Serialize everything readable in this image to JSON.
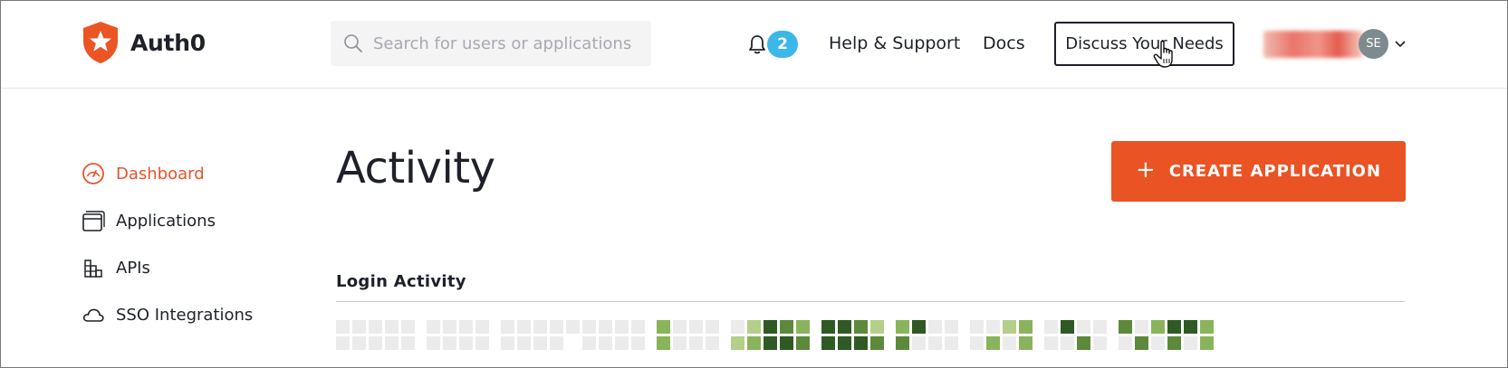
{
  "header": {
    "brand": "Auth0",
    "search_placeholder": "Search for users or applications",
    "notification_count": "2",
    "help_label": "Help & Support",
    "docs_label": "Docs",
    "discuss_label": "Discuss Your Needs",
    "avatar_initials": "SE"
  },
  "sidebar": {
    "items": [
      {
        "label": "Dashboard",
        "icon": "gauge-icon",
        "active": true
      },
      {
        "label": "Applications",
        "icon": "window-stack-icon",
        "active": false
      },
      {
        "label": "APIs",
        "icon": "building-blocks-icon",
        "active": false
      },
      {
        "label": "SSO Integrations",
        "icon": "cloud-icon",
        "active": false
      }
    ]
  },
  "main": {
    "title": "Activity",
    "create_button_label": "CREATE APPLICATION",
    "login_activity_title": "Login Activity"
  },
  "colors": {
    "accent": "#ea5323",
    "active_nav": "#e8532a",
    "badge": "#3db7ea",
    "heat_empty": "#ebebeb",
    "heat_1": "#b3cf8a",
    "heat_2": "#8ab45c",
    "heat_3": "#5d8a3a",
    "heat_4": "#2f5a23"
  },
  "heatmap": {
    "columns": [
      [
        0,
        0
      ],
      [
        0,
        0
      ],
      [
        0,
        0
      ],
      [
        0,
        0
      ],
      [
        0,
        0
      ],
      [
        -1,
        -1
      ],
      [
        0,
        0
      ],
      [
        0,
        0
      ],
      [
        0,
        0
      ],
      [
        0,
        0
      ],
      [
        -1,
        -1
      ],
      [
        0,
        0
      ],
      [
        0,
        0
      ],
      [
        0,
        0
      ],
      [
        0,
        0
      ],
      [
        0,
        -1
      ],
      [
        0,
        0
      ],
      [
        0,
        0
      ],
      [
        0,
        0
      ],
      [
        0,
        0
      ],
      [
        -1,
        -1
      ],
      [
        2,
        2
      ],
      [
        0,
        0
      ],
      [
        0,
        0
      ],
      [
        0,
        0
      ],
      [
        -1,
        -1
      ],
      [
        0,
        1
      ],
      [
        1,
        2
      ],
      [
        4,
        4
      ],
      [
        3,
        4
      ],
      [
        2,
        3
      ],
      [
        -1,
        -1
      ],
      [
        4,
        4
      ],
      [
        4,
        4
      ],
      [
        3,
        4
      ],
      [
        1,
        3
      ],
      [
        -1,
        -1
      ],
      [
        2,
        3
      ],
      [
        4,
        0
      ],
      [
        0,
        0
      ],
      [
        0,
        0
      ],
      [
        -1,
        -1
      ],
      [
        0,
        0
      ],
      [
        0,
        2
      ],
      [
        1,
        0
      ],
      [
        2,
        2
      ],
      [
        -1,
        -1
      ],
      [
        0,
        0
      ],
      [
        4,
        0
      ],
      [
        0,
        3
      ],
      [
        0,
        0
      ],
      [
        -1,
        -1
      ],
      [
        3,
        0
      ],
      [
        0,
        3
      ],
      [
        2,
        0
      ],
      [
        4,
        3
      ],
      [
        4,
        0
      ],
      [
        2,
        2
      ]
    ]
  }
}
